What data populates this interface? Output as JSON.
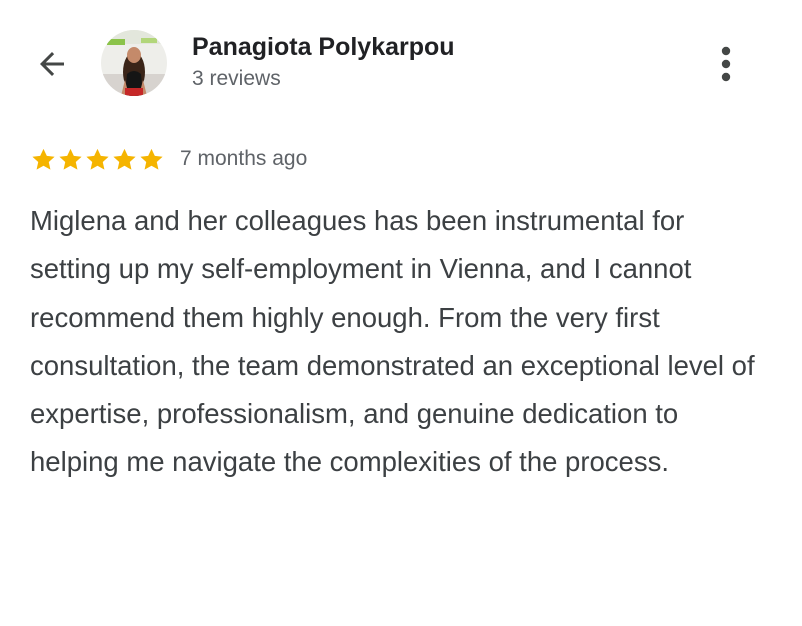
{
  "reviewer": {
    "name": "Panagiota Polykarpou",
    "review_count": "3 reviews"
  },
  "review": {
    "rating": 5,
    "max_rating": 5,
    "timestamp": "7 months ago",
    "text": "Miglena and her colleagues has been instrumental for setting up my self-employment in Vienna, and I cannot recommend them highly enough. From the very first consultation, the team demonstrated an exceptional level of expertise, professionalism, and genuine dedication to helping me navigate the complexities of the process."
  },
  "icons": {
    "back": "arrow-back-icon",
    "more": "more-vert-icon",
    "star": "star-icon"
  },
  "colors": {
    "star": "#f5b400",
    "text_primary": "#202124",
    "text_secondary": "#5f6368",
    "icon": "#444746"
  }
}
